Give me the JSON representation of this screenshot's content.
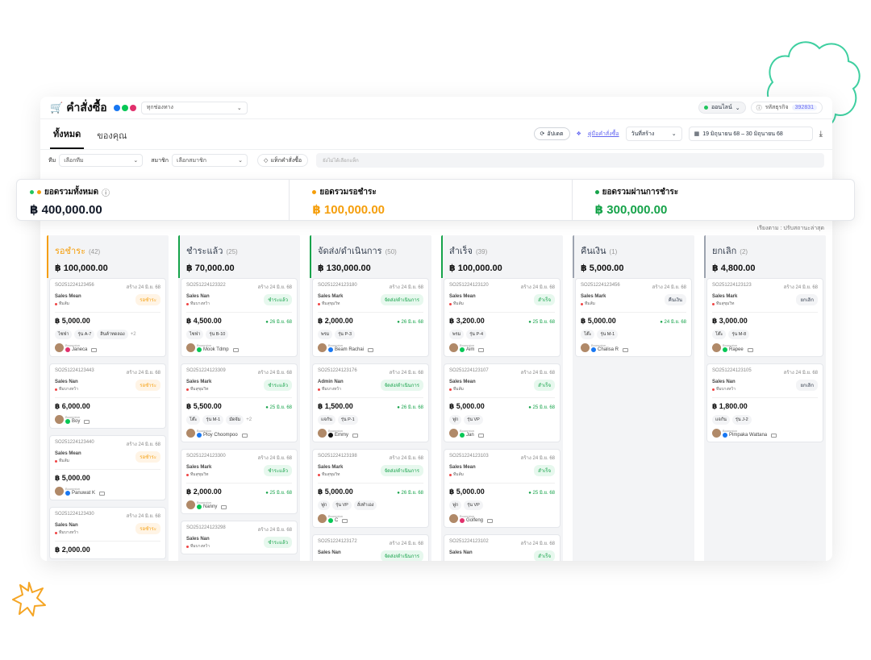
{
  "header": {
    "title": "คำสั่งซื้อ",
    "channel_select": "ทุกช่องทาง",
    "online_status": "ออนไลน์",
    "shop_code_label": "รหัสธุรกิจ",
    "shop_code": "392831"
  },
  "tabs": [
    {
      "label": "ทั้งหมด",
      "active": true
    },
    {
      "label": "ของคุณ",
      "active": false
    }
  ],
  "toolbar": {
    "update_label": "อัปเดต",
    "guide_label": "คู่มือคำสั่งซื้อ",
    "date_type": "วันที่สร้าง",
    "date_range": "19 มิถุนายน 68 – 30 มิถุนายน 68"
  },
  "filters": {
    "team_label": "ทีม",
    "team_placeholder": "เลือกทีม",
    "member_label": "สมาชิก",
    "member_placeholder": "เลือกสมาชิก",
    "tag_button": "แท็กคำสั่งซื้อ",
    "tag_placeholder": "ยังไม่ได้เลือกแท็ก"
  },
  "summary": [
    {
      "label": "ยอดรวมทั้งหมด",
      "value": "฿ 400,000.00",
      "color": "#111827"
    },
    {
      "label": "ยอดรวมรอชำระ",
      "value": "฿ 100,000.00",
      "color": "#f59e0b"
    },
    {
      "label": "ยอดรวมผ่านการชำระ",
      "value": "฿ 300,000.00",
      "color": "#16a34a"
    }
  ],
  "sort_note": "เรียงตาม : ปรับสถานะล่าสุด",
  "columns": [
    {
      "title": "รอชำระ",
      "count": "(42)",
      "total": "฿ 100,000.00",
      "color": "#f59e0b",
      "cards": [
        {
          "id": "SO251224123456",
          "created": "สร้าง 24 มิ.ย. 68",
          "sales": "Sales Mean",
          "staff": "ทีมส้ม",
          "status": "รอชำระ",
          "amount": "฿ 5,000.00",
          "paid_date": "",
          "tags": [
            "ไซฟ่า",
            "รุ่น A-7",
            "สินค้าทดลอง"
          ],
          "more": "+2",
          "customer": "Janeca",
          "source": "ig"
        },
        {
          "id": "SO251224123443",
          "created": "สร้าง 24 มิ.ย. 68",
          "sales": "Sales Nan",
          "staff": "ทีมบางหว้า",
          "status": "รอชำระ",
          "amount": "฿ 6,000.00",
          "paid_date": "",
          "tags": [],
          "more": "",
          "customer": "Boy",
          "source": "line"
        },
        {
          "id": "SO251224123440",
          "created": "สร้าง 24 มิ.ย. 68",
          "sales": "Sales Mean",
          "staff": "ทีมส้ม",
          "status": "รอชำระ",
          "amount": "฿ 5,000.00",
          "paid_date": "",
          "tags": [],
          "more": "",
          "customer": "Panuwat K",
          "source": "fb"
        },
        {
          "id": "SO251224123430",
          "created": "สร้าง 24 มิ.ย. 68",
          "sales": "Sales Nan",
          "staff": "ทีมบางหว้า",
          "status": "รอชำระ",
          "amount": "฿ 2,000.00",
          "paid_date": "",
          "tags": [],
          "more": "",
          "customer": "",
          "source": ""
        }
      ]
    },
    {
      "title": "ชำระแล้ว",
      "count": "(25)",
      "total": "฿ 70,000.00",
      "color": "#16a34a",
      "cards": [
        {
          "id": "SO251224123322",
          "created": "สร้าง 24 มิ.ย. 68",
          "sales": "Sales Nan",
          "staff": "ทีมบางหว้า",
          "status": "ชำระแล้ว",
          "amount": "฿ 4,500.00",
          "paid_date": "26 มิ.ย. 68",
          "tags": [
            "ไซฟ่า",
            "รุ่น B-10"
          ],
          "more": "",
          "customer": "Mook Tdmp",
          "source": "line"
        },
        {
          "id": "SO251224123309",
          "created": "สร้าง 24 มิ.ย. 68",
          "sales": "Sales Mark",
          "staff": "ทีมสุขุมวิท",
          "status": "ชำระแล้ว",
          "amount": "฿ 5,500.00",
          "paid_date": "25 มิ.ย. 68",
          "tags": [
            "โต๊ะ",
            "รุ่น M-1",
            "มัดจัม"
          ],
          "more": "+2",
          "customer": "Ploy Choompoo",
          "source": "fb"
        },
        {
          "id": "SO251224123300",
          "created": "สร้าง 24 มิ.ย. 68",
          "sales": "Sales Mark",
          "staff": "ทีมสุขุมวิท",
          "status": "ชำระแล้ว",
          "amount": "฿ 2,000.00",
          "paid_date": "25 มิ.ย. 68",
          "tags": [],
          "more": "",
          "customer": "Nanny",
          "source": "line"
        },
        {
          "id": "SO251224123298",
          "created": "สร้าง 24 มิ.ย. 68",
          "sales": "Sales Nan",
          "staff": "ทีมบางหว้า",
          "status": "ชำระแล้ว",
          "amount": "",
          "paid_date": "",
          "tags": [],
          "more": "",
          "customer": "",
          "source": ""
        }
      ]
    },
    {
      "title": "จัดส่ง/ดำเนินการ",
      "count": "(50)",
      "total": "฿ 130,000.00",
      "color": "#16a34a",
      "cards": [
        {
          "id": "SO251224123180",
          "created": "สร้าง 24 มิ.ย. 68",
          "sales": "Sales Mark",
          "staff": "ทีมสุขุมวิท",
          "status": "จัดส่ง/ดำเนินการ",
          "amount": "฿ 2,000.00",
          "paid_date": "26 มิ.ย. 68",
          "tags": [
            "พรม",
            "รุ่น P-3"
          ],
          "more": "",
          "customer": "Beam Rachai",
          "source": "fb"
        },
        {
          "id": "SO251224123176",
          "created": "สร้าง 24 มิ.ย. 68",
          "sales": "Admin Nan",
          "staff": "ทีมบางหว้า",
          "status": "จัดส่ง/ดำเนินการ",
          "amount": "฿ 1,500.00",
          "paid_date": "26 มิ.ย. 68",
          "tags": [
            "แจกัน",
            "รุ่น P-1"
          ],
          "more": "",
          "customer": "Emmy",
          "source": "tt"
        },
        {
          "id": "SO251224123198",
          "created": "สร้าง 24 มิ.ย. 68",
          "sales": "Sales Mark",
          "staff": "ทีมสุขุมวิท",
          "status": "จัดส่ง/ดำเนินการ",
          "amount": "฿ 5,000.00",
          "paid_date": "26 มิ.ย. 68",
          "tags": [
            "ฟูก",
            "รุ่น VP",
            "สั่งทำเอง"
          ],
          "more": "",
          "customer": "C",
          "source": "line"
        },
        {
          "id": "SO251224123172",
          "created": "สร้าง 24 มิ.ย. 68",
          "sales": "Sales Nan",
          "staff": "",
          "status": "จัดส่ง/ดำเนินการ",
          "amount": "",
          "paid_date": "",
          "tags": [],
          "more": "",
          "customer": "",
          "source": ""
        }
      ]
    },
    {
      "title": "สำเร็จ",
      "count": "(39)",
      "total": "฿ 100,000.00",
      "color": "#16a34a",
      "cards": [
        {
          "id": "SO251224123120",
          "created": "สร้าง 24 มิ.ย. 68",
          "sales": "Sales Mean",
          "staff": "ทีมส้ม",
          "status": "สำเร็จ",
          "amount": "฿ 3,200.00",
          "paid_date": "25 มิ.ย. 68",
          "tags": [
            "พรม",
            "รุ่น P-4"
          ],
          "more": "",
          "customer": "Aim",
          "source": "line"
        },
        {
          "id": "SO251224123107",
          "created": "สร้าง 24 มิ.ย. 68",
          "sales": "Sales Mean",
          "staff": "ทีมส้ม",
          "status": "สำเร็จ",
          "amount": "฿ 5,000.00",
          "paid_date": "25 มิ.ย. 68",
          "tags": [
            "ฟูก",
            "รุ่น VP"
          ],
          "more": "",
          "customer": "Jan",
          "source": "line"
        },
        {
          "id": "SO251224123103",
          "created": "สร้าง 24 มิ.ย. 68",
          "sales": "Sales Mean",
          "staff": "ทีมส้ม",
          "status": "สำเร็จ",
          "amount": "฿ 5,000.00",
          "paid_date": "25 มิ.ย. 68",
          "tags": [
            "ฟูก",
            "รุ่น VP"
          ],
          "more": "",
          "customer": "Golfeng",
          "source": "ig"
        },
        {
          "id": "SO251224123102",
          "created": "สร้าง 24 มิ.ย. 68",
          "sales": "Sales Nan",
          "staff": "",
          "status": "สำเร็จ",
          "amount": "",
          "paid_date": "",
          "tags": [],
          "more": "",
          "customer": "",
          "source": ""
        }
      ]
    },
    {
      "title": "คืนเงิน",
      "count": "(1)",
      "total": "฿ 5,000.00",
      "color": "#9ca3af",
      "cards": [
        {
          "id": "SO251224123456",
          "created": "สร้าง 24 มิ.ย. 68",
          "sales": "Sales Mark",
          "staff": "ทีมส้ม",
          "status": "คืนเงิน",
          "amount": "฿ 5,000.00",
          "paid_date": "24 มิ.ย. 68",
          "tags": [
            "โต๊ะ",
            "รุ่น M-1"
          ],
          "more": "",
          "customer": "Chalisa R",
          "source": "fb"
        }
      ]
    },
    {
      "title": "ยกเลิก",
      "count": "(2)",
      "total": "฿ 4,800.00",
      "color": "#9ca3af",
      "cards": [
        {
          "id": "SO251224123123",
          "created": "สร้าง 24 มิ.ย. 68",
          "sales": "Sales Mark",
          "staff": "ทีมสุขุมวิท",
          "status": "ยกเลิก",
          "amount": "฿ 3,000.00",
          "paid_date": "",
          "tags": [
            "โต๊ะ",
            "รุ่น M-8"
          ],
          "more": "",
          "customer": "Rapee",
          "source": "line"
        },
        {
          "id": "SO251224123105",
          "created": "สร้าง 24 มิ.ย. 68",
          "sales": "Sales Nan",
          "staff": "ทีมบางหว้า",
          "status": "ยกเลิก",
          "amount": "฿ 1,800.00",
          "paid_date": "",
          "tags": [
            "แจกัน",
            "รุ่น J-2"
          ],
          "more": "",
          "customer": "Pimpaka Wattana",
          "source": "fb"
        }
      ]
    }
  ],
  "card_common": {
    "boonmion": "Boonmion"
  },
  "colors": {
    "accent": "#ef4444",
    "pending": "#f59e0b",
    "paid": "#16a34a",
    "decor": "#3ecfa0",
    "star": "#f5a524"
  }
}
